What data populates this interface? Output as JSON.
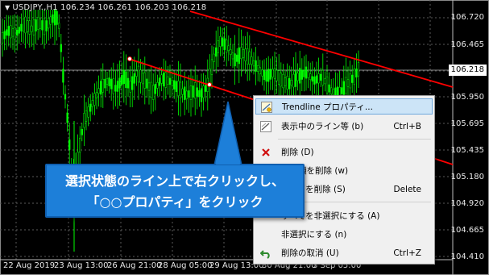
{
  "symbol": {
    "title": "USDJPY.,H1  106.234 106.261 106.203 106.218"
  },
  "price_axis": {
    "ticks": [
      "106.720",
      "106.465",
      "105.950",
      "105.695",
      "105.435",
      "105.180",
      "104.920",
      "104.665",
      "104.410"
    ],
    "current": "106.218"
  },
  "time_axis": {
    "ticks": [
      "22 Aug 2019",
      "23 Aug 13:00",
      "26 Aug 21:00",
      "28 Aug 05:00",
      "29 Aug 13:00",
      "30 Aug 21:00",
      "3 Sep 05:00"
    ]
  },
  "context_menu": {
    "items": [
      {
        "label": "Trendline プロパティ...",
        "shortcut": "",
        "icon": "trendline-properties-icon"
      },
      {
        "label": "表示中のライン等 (b)",
        "shortcut": "Ctrl+B",
        "icon": "objects-list-icon"
      },
      {
        "label": "削除 (D)",
        "shortcut": "",
        "icon": "delete-icon"
      },
      {
        "label": "矢印類を削除 (w)",
        "shortcut": "",
        "icon": ""
      },
      {
        "label": "すべてを削除 (S)",
        "shortcut": "Delete",
        "icon": ""
      },
      {
        "label": "すべてを非選択にする (A)",
        "shortcut": "",
        "icon": ""
      },
      {
        "label": "非選択にする (n)",
        "shortcut": "",
        "icon": ""
      },
      {
        "label": "削除の取消 (U)",
        "shortcut": "Ctrl+Z",
        "icon": "undo-icon"
      }
    ]
  },
  "callout": {
    "line1": "選択状態のライン上で右クリックし、",
    "line2": "「○○プロパティ」をクリック"
  },
  "colors": {
    "candle": "#00ff00",
    "trendline": "#ff0000",
    "callout": "#1d7fd9"
  }
}
